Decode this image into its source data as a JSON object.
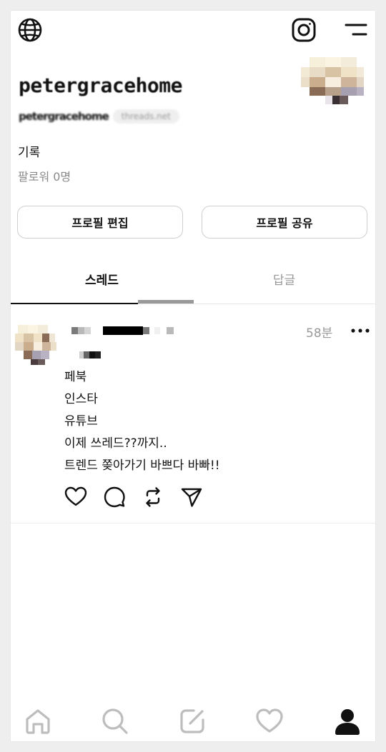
{
  "header": {
    "icons": [
      "globe-icon",
      "instagram-icon",
      "menu-icon"
    ]
  },
  "profile": {
    "username": "petergracehome",
    "handle": "petergracehome",
    "domain_badge": "threads.net",
    "bio": "기록",
    "followers": "팔로워 0명",
    "edit_button": "프로필 편집",
    "share_button": "프로필 공유"
  },
  "tabs": [
    {
      "label": "스레드",
      "active": true
    },
    {
      "label": "답글",
      "active": false
    }
  ],
  "post": {
    "time": "58분",
    "lines": [
      "페북",
      "인스타",
      "유튜브",
      "이제 쓰레드??까지..",
      "트렌드 쫒아가기 바쁘다 바빠!!"
    ],
    "actions": [
      "heart-icon",
      "comment-icon",
      "repost-icon",
      "send-icon"
    ]
  },
  "bottom_nav": [
    "home-icon",
    "search-icon",
    "compose-icon",
    "activity-icon",
    "profile-icon"
  ],
  "colors": {
    "text": "#111111",
    "muted": "#999999",
    "border": "#cfcfcf"
  }
}
